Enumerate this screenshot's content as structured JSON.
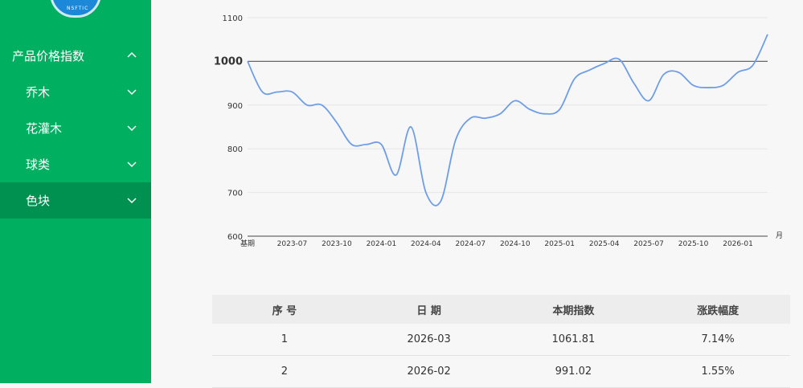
{
  "sidebar": {
    "logo_text": "NSFTIC",
    "menu": [
      {
        "label": "产品价格指数",
        "chevron": "chevron-up",
        "level": 0
      },
      {
        "label": "乔木",
        "chevron": "chevron-down",
        "level": 1
      },
      {
        "label": "花灌木",
        "chevron": "chevron-down",
        "level": 1
      },
      {
        "label": "球类",
        "chevron": "chevron-down",
        "level": 1
      },
      {
        "label": "色块",
        "chevron": "chevron-down",
        "level": 1,
        "active": true
      }
    ]
  },
  "chart_data": {
    "type": "line",
    "x_unit_label": "月",
    "ylim": [
      600,
      1100
    ],
    "yticks": [
      600,
      700,
      800,
      900,
      1000,
      1100
    ],
    "reference_line": 1000,
    "x_tick_labels": [
      "基期",
      "2023-07",
      "2023-10",
      "2024-01",
      "2024-04",
      "2024-07",
      "2024-10",
      "2025-01",
      "2025-04",
      "2025-07",
      "2025-10",
      "2026-01"
    ],
    "series": [
      {
        "color": "#6f9ee8",
        "x": [
          "基期",
          "2023-05",
          "2023-06",
          "2023-07",
          "2023-08",
          "2023-09",
          "2023-10",
          "2023-11",
          "2023-12",
          "2024-01",
          "2024-02",
          "2024-03",
          "2024-04",
          "2024-05",
          "2024-06",
          "2024-07",
          "2024-08",
          "2024-09",
          "2024-10",
          "2024-11",
          "2024-12",
          "2025-01",
          "2025-02",
          "2025-03",
          "2025-04",
          "2025-05",
          "2025-06",
          "2025-07",
          "2025-08",
          "2025-09",
          "2025-10",
          "2025-11",
          "2025-12",
          "2026-01",
          "2026-02",
          "2026-03"
        ],
        "values": [
          1000,
          930,
          930,
          930,
          900,
          900,
          860,
          810,
          810,
          810,
          740,
          850,
          700,
          680,
          820,
          870,
          870,
          880,
          910,
          890,
          880,
          890,
          960,
          980,
          995,
          1005,
          950,
          910,
          970,
          975,
          945,
          940,
          945,
          975,
          991.02,
          1061.81
        ]
      }
    ],
    "grid": true
  },
  "table": {
    "headers": [
      "序 号",
      "日 期",
      "本期指数",
      "涨跌幅度"
    ],
    "rows": [
      [
        "1",
        "2026-03",
        "1061.81",
        "7.14%"
      ],
      [
        "2",
        "2026-02",
        "991.02",
        "1.55%"
      ]
    ]
  },
  "colors": {
    "sidebar_bg": "#00b060",
    "sidebar_active": "#009050",
    "line": "#6f9ee8"
  }
}
